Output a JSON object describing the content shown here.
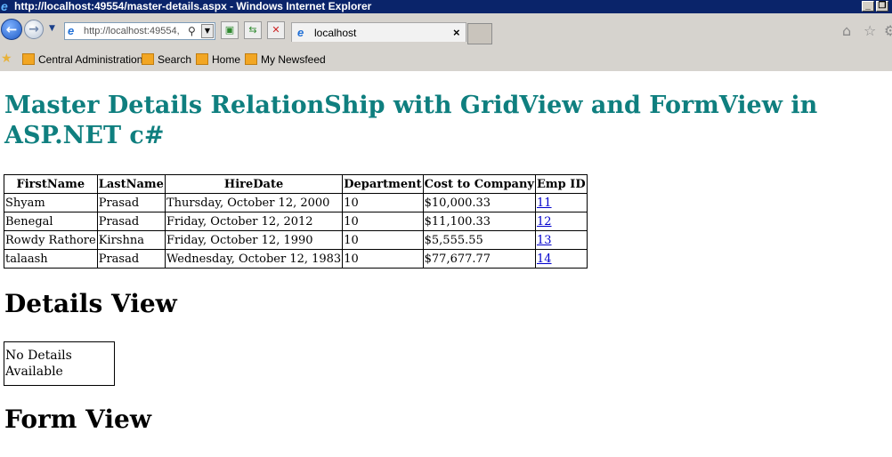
{
  "window": {
    "title": "http://localhost:49554/master-details.aspx - Windows Internet Explorer"
  },
  "navbar": {
    "address": "http://localhost:49554,",
    "tab_label": "localhost",
    "tab_close": "×"
  },
  "favorites": [
    {
      "label": "Central Administration"
    },
    {
      "label": "Search"
    },
    {
      "label": "Home"
    },
    {
      "label": "My Newsfeed"
    }
  ],
  "page": {
    "title": "Master Details RelationShip with GridView and FormView in ASP.NET c#",
    "grid": {
      "columns": [
        "FirstName",
        "LastName",
        "HireDate",
        "Department",
        "Cost to Company",
        "Emp ID"
      ],
      "rows": [
        [
          "Shyam",
          "Prasad",
          "Thursday, October 12, 2000",
          "10",
          "$10,000.33",
          "11"
        ],
        [
          "Benegal",
          "Prasad",
          "Friday, October 12, 2012",
          "10",
          "$11,100.33",
          "12"
        ],
        [
          "Rowdy Rathore",
          "Kirshna",
          "Friday, October 12, 1990",
          "10",
          "$5,555.55",
          "13"
        ],
        [
          "talaash",
          "Prasad",
          "Wednesday, October 12, 1983",
          "10",
          "$77,677.77",
          "14"
        ]
      ]
    },
    "details_heading": "Details View",
    "details_empty_text": "No Details Available",
    "form_heading": "Form View"
  }
}
